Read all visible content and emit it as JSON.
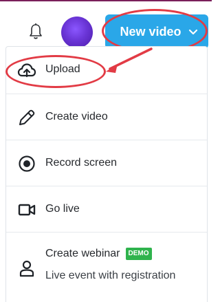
{
  "header": {
    "new_video_label": "New video"
  },
  "menu": {
    "items": [
      {
        "label": "Upload"
      },
      {
        "label": "Create video"
      },
      {
        "label": "Record screen"
      },
      {
        "label": "Go live"
      },
      {
        "label": "Create webinar",
        "badge": "DEMO",
        "sublabel": "Live event with registration"
      }
    ]
  },
  "colors": {
    "accent": "#2aa7e8",
    "annotation": "#e23b45",
    "badge": "#2fb34d",
    "avatar": "#6a35d6"
  }
}
